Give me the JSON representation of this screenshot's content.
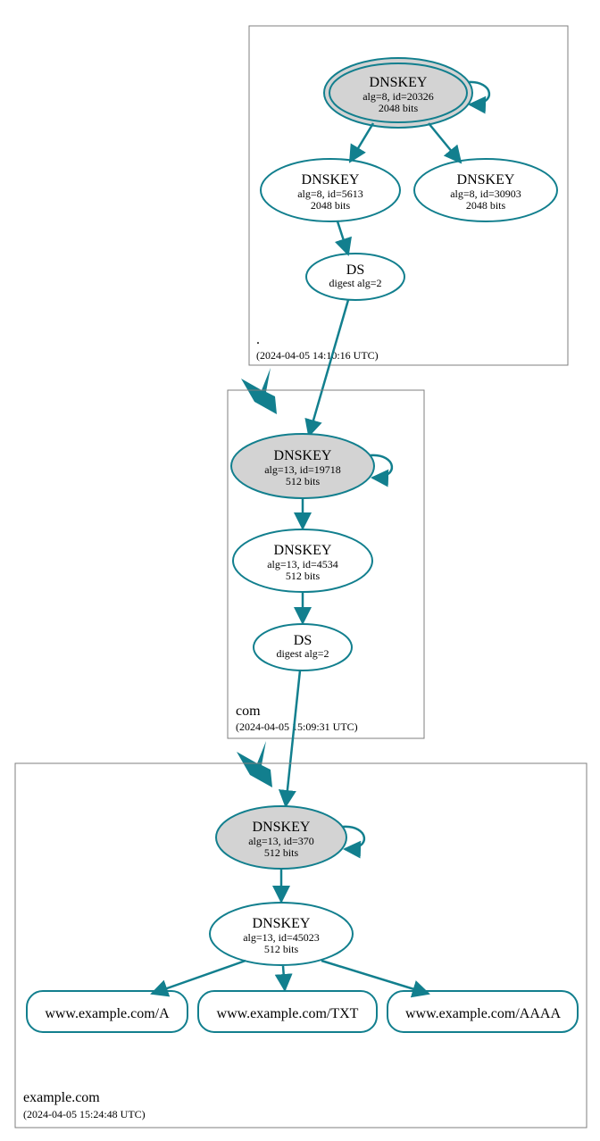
{
  "colors": {
    "stroke": "#127f8e",
    "ksk_fill": "#d3d3d3",
    "cluster_stroke": "#7f7f7f"
  },
  "zones": {
    "root": {
      "name": ".",
      "timestamp": "(2024-04-05 14:10:16 UTC)"
    },
    "com": {
      "name": "com",
      "timestamp": "(2024-04-05 15:09:31 UTC)"
    },
    "example": {
      "name": "example.com",
      "timestamp": "(2024-04-05 15:24:48 UTC)"
    }
  },
  "nodes": {
    "root_ksk": {
      "title": "DNSKEY",
      "l2": "alg=8, id=20326",
      "l3": "2048 bits"
    },
    "root_zsk1": {
      "title": "DNSKEY",
      "l2": "alg=8, id=5613",
      "l3": "2048 bits"
    },
    "root_zsk2": {
      "title": "DNSKEY",
      "l2": "alg=8, id=30903",
      "l3": "2048 bits"
    },
    "root_ds": {
      "title": "DS",
      "l2": "digest alg=2"
    },
    "com_ksk": {
      "title": "DNSKEY",
      "l2": "alg=13, id=19718",
      "l3": "512 bits"
    },
    "com_zsk": {
      "title": "DNSKEY",
      "l2": "alg=13, id=4534",
      "l3": "512 bits"
    },
    "com_ds": {
      "title": "DS",
      "l2": "digest alg=2"
    },
    "ex_ksk": {
      "title": "DNSKEY",
      "l2": "alg=13, id=370",
      "l3": "512 bits"
    },
    "ex_zsk": {
      "title": "DNSKEY",
      "l2": "alg=13, id=45023",
      "l3": "512 bits"
    },
    "rr_a": {
      "label": "www.example.com/A"
    },
    "rr_txt": {
      "label": "www.example.com/TXT"
    },
    "rr_aaaa": {
      "label": "www.example.com/AAAA"
    }
  }
}
